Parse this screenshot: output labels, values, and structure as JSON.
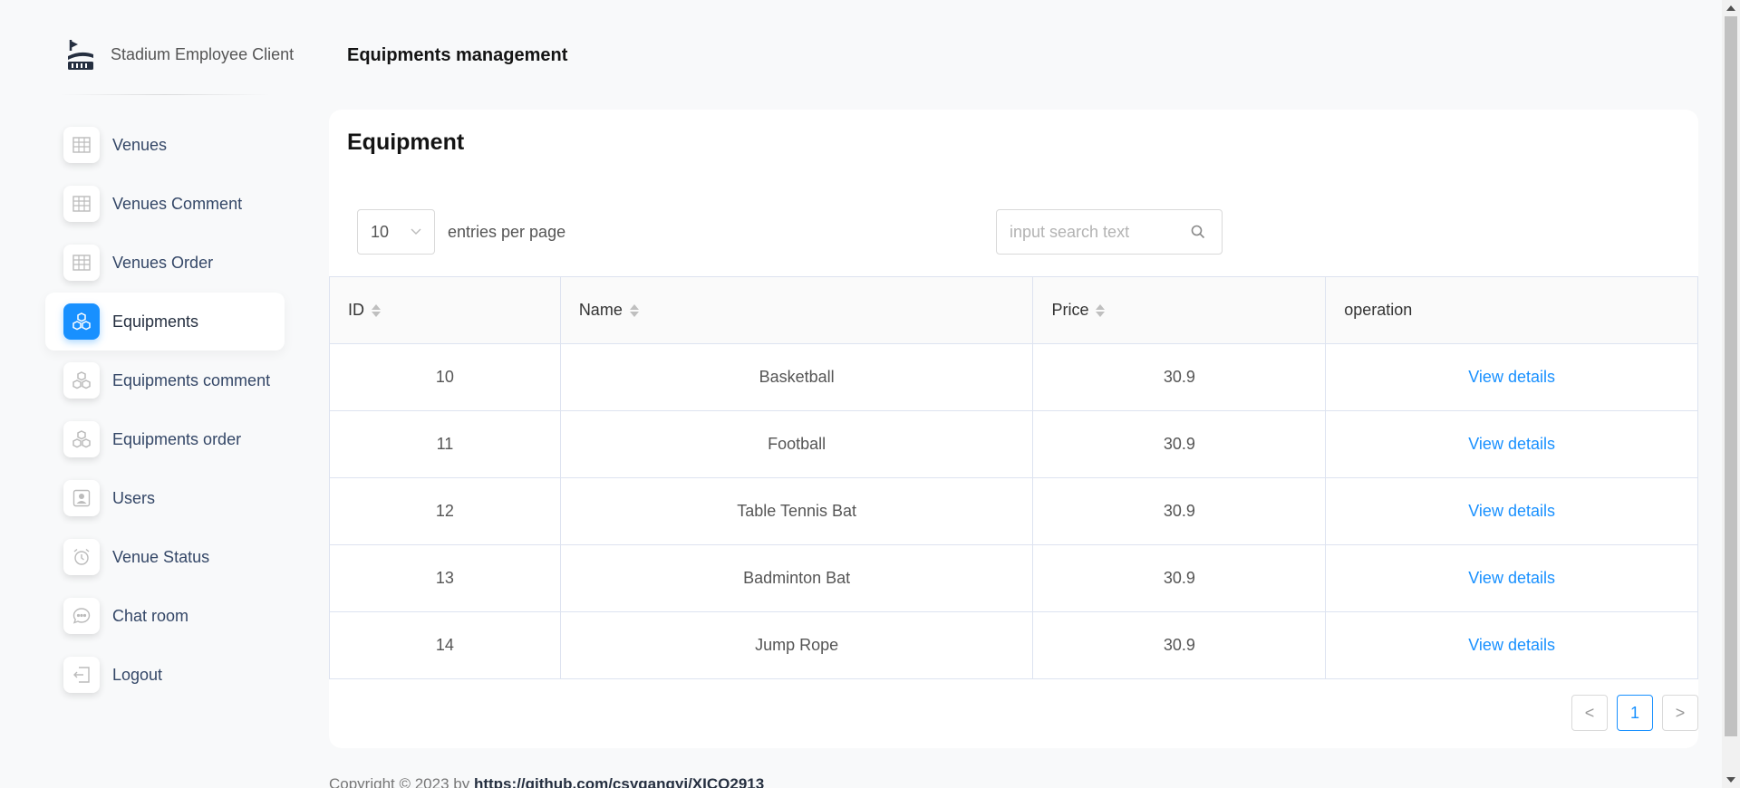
{
  "brand": {
    "title": "Stadium Employee Client"
  },
  "sidebar": {
    "items": [
      {
        "label": "Venues",
        "icon": "table-icon"
      },
      {
        "label": "Venues Comment",
        "icon": "table-icon"
      },
      {
        "label": "Venues Order",
        "icon": "table-icon"
      },
      {
        "label": "Equipments",
        "icon": "cubes-icon",
        "active": true
      },
      {
        "label": "Equipments comment",
        "icon": "cubes-icon"
      },
      {
        "label": "Equipments order",
        "icon": "cubes-icon"
      },
      {
        "label": "Users",
        "icon": "user-icon"
      },
      {
        "label": "Venue Status",
        "icon": "alarm-icon"
      },
      {
        "label": "Chat room",
        "icon": "chat-icon"
      },
      {
        "label": "Logout",
        "icon": "logout-icon"
      }
    ]
  },
  "header": {
    "title": "Equipments management"
  },
  "card": {
    "title": "Equipment",
    "per_page_value": "10",
    "per_page_label": "entries per page",
    "search_placeholder": "input search text"
  },
  "table": {
    "columns": [
      "ID",
      "Name",
      "Price",
      "operation"
    ],
    "rows": [
      {
        "id": "10",
        "name": "Basketball",
        "price": "30.9",
        "action": "View details"
      },
      {
        "id": "11",
        "name": "Football",
        "price": "30.9",
        "action": "View details"
      },
      {
        "id": "12",
        "name": "Table Tennis Bat",
        "price": "30.9",
        "action": "View details"
      },
      {
        "id": "13",
        "name": "Badminton Bat",
        "price": "30.9",
        "action": "View details"
      },
      {
        "id": "14",
        "name": "Jump Rope",
        "price": "30.9",
        "action": "View details"
      }
    ]
  },
  "pagination": {
    "prev": "<",
    "current": "1",
    "next": ">"
  },
  "footer": {
    "text": "Copyright © 2023 by ",
    "link": "https://github.com/csygangyi/XICO2913"
  },
  "colors": {
    "accent": "#1890ff",
    "background": "#f8f9fa"
  }
}
